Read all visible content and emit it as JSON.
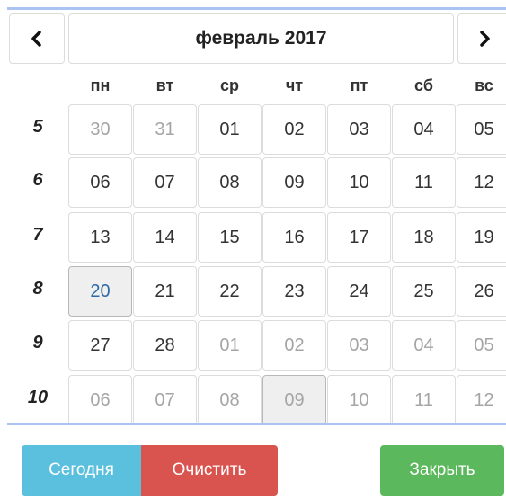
{
  "header": {
    "title": "февраль 2017",
    "prev_icon": "chevron-left-icon",
    "next_icon": "chevron-right-icon"
  },
  "weekdays": [
    "пн",
    "вт",
    "ср",
    "чт",
    "пт",
    "сб",
    "вс"
  ],
  "weeks": [
    {
      "number": "5",
      "days": [
        "30",
        "31",
        "01",
        "02",
        "03",
        "04",
        "05"
      ]
    },
    {
      "number": "6",
      "days": [
        "06",
        "07",
        "08",
        "09",
        "10",
        "11",
        "12"
      ]
    },
    {
      "number": "7",
      "days": [
        "13",
        "14",
        "15",
        "16",
        "17",
        "18",
        "19"
      ]
    },
    {
      "number": "8",
      "days": [
        "20",
        "21",
        "22",
        "23",
        "24",
        "25",
        "26"
      ]
    },
    {
      "number": "9",
      "days": [
        "27",
        "28",
        "01",
        "02",
        "03",
        "04",
        "05"
      ]
    },
    {
      "number": "10",
      "days": [
        "06",
        "07",
        "08",
        "09",
        "10",
        "11",
        "12"
      ]
    }
  ],
  "buttons": {
    "today": "Сегодня",
    "clear": "Очистить",
    "close": "Закрыть"
  },
  "colors": {
    "today_bg": "#5bc0de",
    "clear_bg": "#d9534f",
    "close_bg": "#5cb85c",
    "selected_text": "#2d6ba8",
    "other_month_text": "#a5a5a5"
  }
}
